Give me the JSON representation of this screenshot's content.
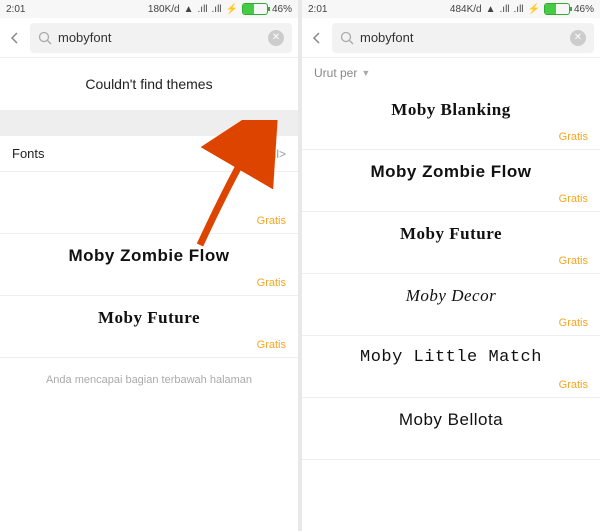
{
  "status": {
    "time": "2:01",
    "net1": "180K/d",
    "net2": "484K/d",
    "battery": "46%"
  },
  "search": {
    "query": "mobyfont"
  },
  "left": {
    "not_found": "Couldn't find themes",
    "section": "Fonts",
    "viewall": "View all>",
    "items": [
      {
        "name": "",
        "price": "Gratis"
      },
      {
        "name": "Moby Zombie Flow",
        "price": "Gratis",
        "cls": "f2"
      },
      {
        "name": "Moby Future",
        "price": "Gratis",
        "cls": "f3"
      }
    ],
    "bottom": "Anda mencapai bagian terbawah halaman"
  },
  "right": {
    "sort": "Urut per",
    "items": [
      {
        "name": "Moby Blanking",
        "price": "Gratis",
        "cls": "f1"
      },
      {
        "name": "Moby Zombie Flow",
        "price": "Gratis",
        "cls": "f2"
      },
      {
        "name": "Moby Future",
        "price": "Gratis",
        "cls": "f3"
      },
      {
        "name": "Moby Decor",
        "price": "Gratis",
        "cls": "f4"
      },
      {
        "name": "Moby Little Match",
        "price": "Gratis",
        "cls": "f5"
      },
      {
        "name": "Moby Bellota",
        "price": "",
        "cls": "f6"
      }
    ]
  }
}
